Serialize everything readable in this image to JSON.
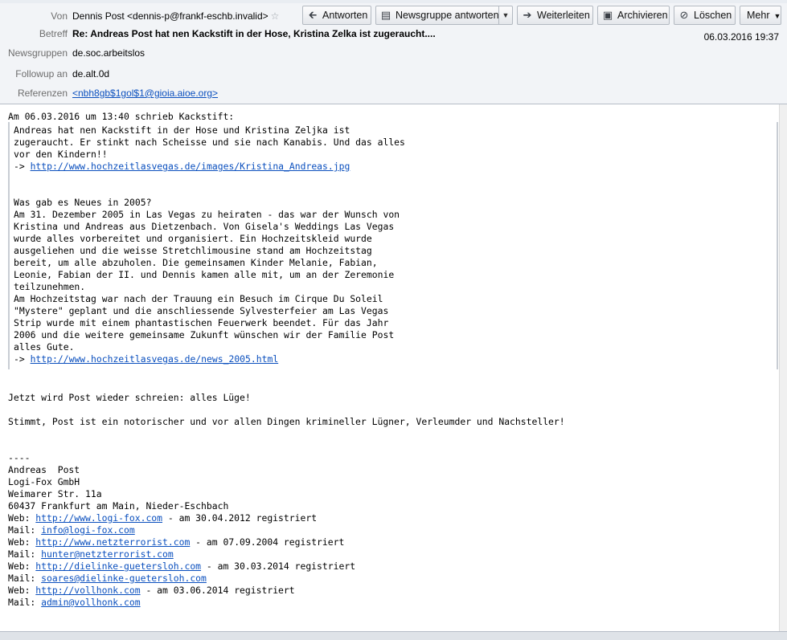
{
  "header": {
    "from_label": "Von",
    "from_value": "Dennis Post <dennis-p@frankf-eschb.invalid>",
    "subject_label": "Betreff",
    "subject_value": "Re: Andreas Post hat nen Kackstift in der Hose, Kristina Zelka ist zugeraucht....",
    "date": "06.03.2016 19:37",
    "newsgroups_label": "Newsgruppen",
    "newsgroups_value": "de.soc.arbeitslos",
    "followup_label": "Followup an",
    "followup_value": "de.alt.0d",
    "references_label": "Referenzen",
    "references_value": "<nbh8gb$1gol$1@gioia.aioe.org>"
  },
  "toolbar": {
    "reply": "Antworten",
    "reply_group": "Newsgruppe antworten",
    "forward": "Weiterleiten",
    "archive": "Archivieren",
    "delete": "Löschen",
    "more": "Mehr"
  },
  "icons": {
    "star": "star-outline-icon",
    "reply": "reply-arrow-icon",
    "reply_group": "newsgroup-reply-icon",
    "forward": "forward-arrow-icon",
    "archive": "archive-box-icon",
    "delete": "delete-circle-icon",
    "dropdown": "chevron-down-icon"
  },
  "body": {
    "intro": "Am 06.03.2016 um 13:40 schrieb Kackstift:",
    "quote": {
      "p1": [
        "Andreas hat nen Kackstift in der Hose und Kristina Zeljka ist",
        "zugeraucht. Er stinkt nach Scheisse und sie nach Kanabis. Und das alles",
        "vor den Kindern!!"
      ],
      "link1_prefix": "-> ",
      "link1": "http://www.hochzeitlasvegas.de/images/Kristina_Andreas.jpg",
      "p2": [
        "Was gab es Neues in 2005?",
        "Am 31. Dezember 2005 in Las Vegas zu heiraten - das war der Wunsch von",
        "Kristina und Andreas aus Dietzenbach. Von Gisela's Weddings Las Vegas",
        "wurde alles vorbereitet und organisiert. Ein Hochzeitskleid wurde",
        "ausgeliehen und die weisse Stretchlimousine stand am Hochzeitstag",
        "bereit, um alle abzuholen. Die gemeinsamen Kinder Melanie, Fabian,",
        "Leonie, Fabian der II. und Dennis kamen alle mit, um an der Zeremonie",
        "teilzunehmen.",
        "Am Hochzeitstag war nach der Trauung ein Besuch im Cirque Du Soleil",
        "\"Mystere\" geplant und die anschliessende Sylvesterfeier am Las Vegas",
        "Strip wurde mit einem phantastischen Feuerwerk beendet. Für das Jahr",
        "2006 und die weitere gemeinsame Zukunft wünschen wir der Familie Post",
        "alles Gute."
      ],
      "link2_prefix": "-> ",
      "link2": "http://www.hochzeitlasvegas.de/news_2005.html"
    },
    "line_a": "Jetzt wird Post wieder schreien: alles Lüge!",
    "line_b": "Stimmt, Post ist ein notorischer und vor allen Dingen krimineller Lügner, Verleumder und Nachsteller!",
    "sig_sep": "----",
    "sig": [
      "Andreas  Post",
      "Logi-Fox GmbH",
      "Weimarer Str. 11a",
      "60437 Frankfurt am Main, Nieder-Eschbach"
    ],
    "web_label": "Web: ",
    "mail_label": "Mail: ",
    "contacts": [
      {
        "web": "http://www.logi-fox.com",
        "web_suffix": " - am 30.04.2012 registriert",
        "mail": "info@logi-fox.com"
      },
      {
        "web": "http://www.netzterrorist.com",
        "web_suffix": " - am 07.09.2004 registriert",
        "mail": "hunter@netzterrorist.com"
      },
      {
        "web": "http://dielinke-guetersloh.com",
        "web_suffix": " - am 30.03.2014 registriert",
        "mail": "soares@dielinke-guetersloh.com"
      },
      {
        "web": "http://vollhonk.com",
        "web_suffix": " - am 03.06.2014 registriert",
        "mail": "admin@vollhonk.com"
      }
    ]
  }
}
